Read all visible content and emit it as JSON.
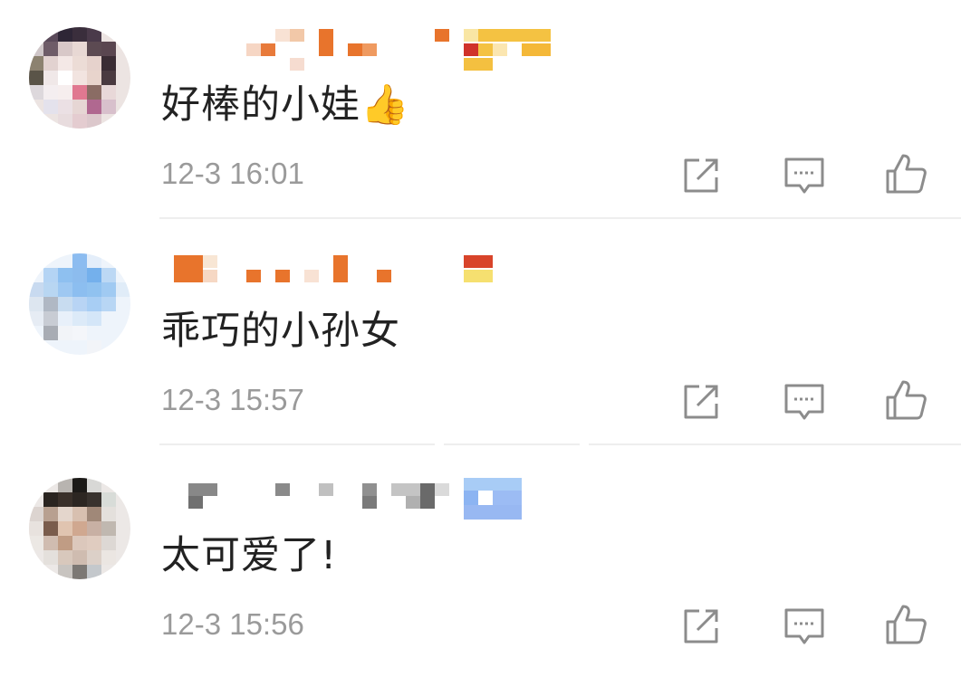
{
  "comments": [
    {
      "text": "好棒的小娃👍",
      "time": "12-3 16:01",
      "avatar_icon": "blurred-avatar-photo",
      "name_pixelated": true
    },
    {
      "text": "乖巧的小孙女",
      "time": "12-3 15:57",
      "avatar_icon": "blurred-avatar-photo",
      "name_pixelated": true
    },
    {
      "text": "太可爱了!",
      "time": "12-3 15:56",
      "avatar_icon": "blurred-avatar-photo",
      "name_pixelated": true
    }
  ],
  "actions": {
    "share_icon": "share-icon",
    "reply_icon": "reply-icon",
    "like_icon": "like-icon"
  },
  "colors": {
    "text": "#222222",
    "meta": "#9a9a9a",
    "icon": "#8c8c8c",
    "divider": "#eeeeee"
  }
}
